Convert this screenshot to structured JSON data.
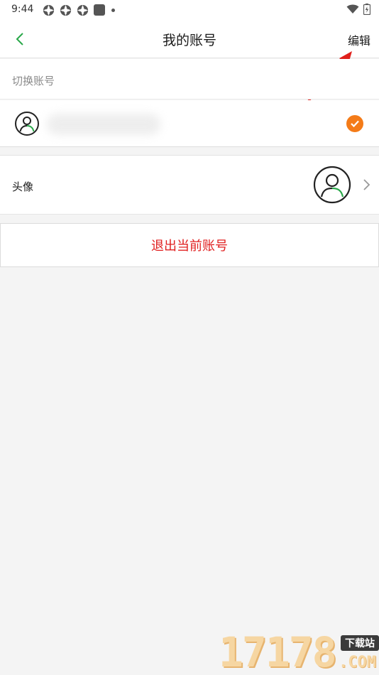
{
  "status_bar": {
    "time": "9:44",
    "notification_icons": [
      "app-notification-icon",
      "app-notification-icon",
      "app-notification-icon",
      "square-notification-icon",
      "dot-icon"
    ],
    "system_icons": [
      "wifi-icon",
      "battery-charging-icon"
    ]
  },
  "header": {
    "back_icon": "chevron-left-icon",
    "title": "我的账号",
    "edit_label": "编辑"
  },
  "switch_account": {
    "section_label": "切换账号",
    "accounts": [
      {
        "name": "",
        "selected": true,
        "avatar_icon": "user-circle-icon",
        "check_icon": "check-circle-icon"
      }
    ]
  },
  "profile": {
    "avatar_label": "头像",
    "avatar_icon": "user-circle-icon",
    "chevron_icon": "chevron-right-icon"
  },
  "logout": {
    "label": "退出当前账号"
  },
  "watermark": {
    "number": "17178",
    "badge": "下载站",
    "domain": ".COM"
  },
  "colors": {
    "accent_orange": "#f47b18",
    "logout_red": "#e02020",
    "avatar_green": "#2aa84a",
    "annotation_arrow": "#e0201c",
    "background": "#f4f4f4"
  }
}
